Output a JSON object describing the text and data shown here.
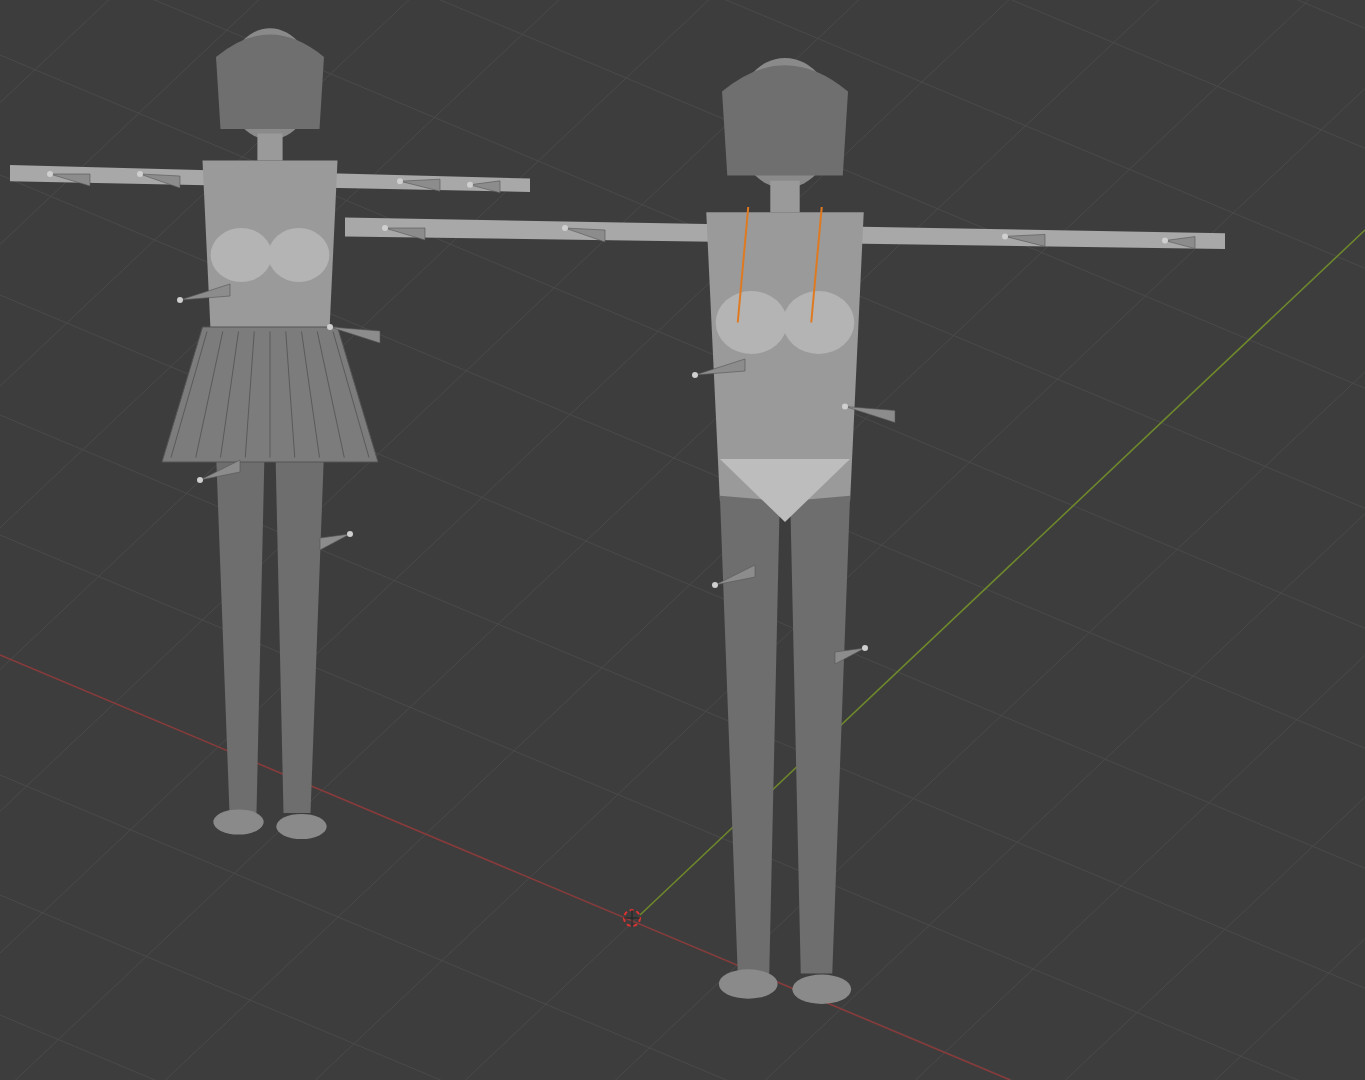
{
  "viewport": {
    "show_grid": true,
    "show_axes": true,
    "show_cursor": true,
    "models": [
      {
        "kind": "skirt"
      },
      {
        "kind": "swimsuit"
      }
    ]
  }
}
